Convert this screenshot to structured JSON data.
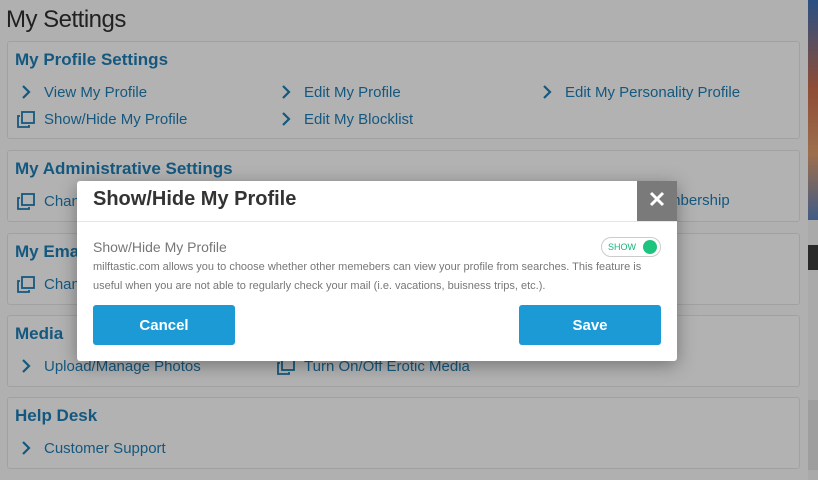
{
  "page": {
    "title": "My Settings"
  },
  "profile_settings": {
    "title": "My Profile Settings",
    "links": [
      "View My Profile",
      "Edit My Profile",
      "Edit My Personality Profile",
      "Show/Hide My Profile",
      "Edit My Blocklist"
    ]
  },
  "admin_settings": {
    "title": "My Administrative Settings",
    "links": [
      "Chan",
      "mbership"
    ]
  },
  "email_settings": {
    "title": "My Ema",
    "links": [
      "Chan"
    ]
  },
  "media": {
    "title": "Media",
    "links": [
      "Upload/Manage Photos",
      "Turn On/Off Erotic Media"
    ]
  },
  "help": {
    "title": "Help Desk",
    "links": [
      "Customer Support"
    ]
  },
  "modal": {
    "title": "Show/Hide My Profile",
    "close_icon": "close-icon",
    "option_label": "Show/Hide My Profile",
    "toggle_text": "SHOW",
    "toggle_color": "#1dc47d",
    "description": "milftastic.com allows you to choose whether other memebers can view your profile from searches. This feature is useful when you are not able to regularly check your mail (i.e. vacations, buisness trips, etc.).",
    "cancel_label": "Cancel",
    "save_label": "Save"
  },
  "colors": {
    "link": "#1e7bb0",
    "button": "#1c9ad6"
  }
}
